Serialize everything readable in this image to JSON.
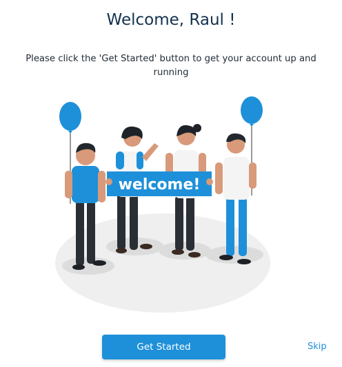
{
  "header": {
    "title": "Welcome, Raul !",
    "subtitle": "Please click the 'Get Started' button to get your account up and running"
  },
  "illustration": {
    "banner_text": "welcome!"
  },
  "actions": {
    "primary_label": "Get Started",
    "skip_label": "Skip"
  },
  "colors": {
    "accent": "#1e90d9",
    "title": "#13324f"
  }
}
